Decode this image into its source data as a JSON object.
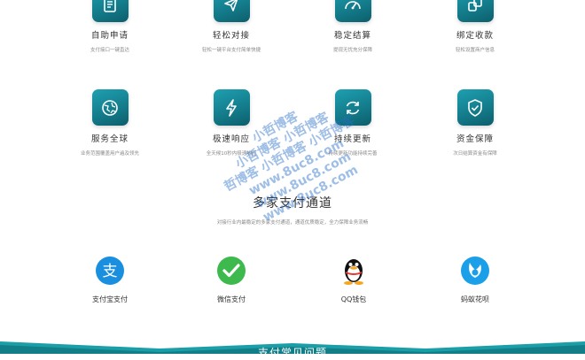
{
  "features": [
    {
      "title": "自助申请",
      "desc": "支付接口一键直达",
      "icon": "document-icon"
    },
    {
      "title": "轻松对接",
      "desc": "轻松一键平台支付简单快捷",
      "icon": "paper-plane-icon"
    },
    {
      "title": "稳定结算",
      "desc": "提现无忧充分保障",
      "icon": "speedometer-icon"
    },
    {
      "title": "绑定收款",
      "desc": "轻松设置商户信息",
      "icon": "link-icon"
    },
    {
      "title": "服务全球",
      "desc": "业务范围覆盖用户遍及领先",
      "icon": "globe-icon"
    },
    {
      "title": "极速响应",
      "desc": "全天候10秒内极速响应",
      "icon": "lightning-icon"
    },
    {
      "title": "持续更新",
      "desc": "持续更新功能持续完善",
      "icon": "refresh-icon"
    },
    {
      "title": "资金保障",
      "desc": "次日结算资金有保障",
      "icon": "shield-check-icon"
    }
  ],
  "channels": {
    "title": "多家支付通道",
    "subtitle": "对接行业内最稳定的多家支付通道，通道优质稳定，全力保障业务流畅",
    "items": [
      {
        "label": "支付宝支付",
        "icon": "alipay-icon",
        "color": "#1a8fe0"
      },
      {
        "label": "微信支付",
        "icon": "wechat-pay-icon",
        "color": "#3eb94e"
      },
      {
        "label": "QQ钱包",
        "icon": "qq-penguin-icon",
        "color": "#111111"
      },
      {
        "label": "蚂蚁花呗",
        "icon": "huabei-icon",
        "color": "#1a9fe8"
      }
    ]
  },
  "watermark": [
    "小哲博客",
    "小哲博客 小哲博客",
    "哲博客 小哲博客 小哲博客",
    "www.8uc8.com",
    "www.8uc8.com",
    "www.8uc8.com"
  ],
  "footer": {
    "title": "支付常见问题"
  },
  "colors": {
    "accent": "#137a89",
    "footer": "#1a9fa8"
  }
}
